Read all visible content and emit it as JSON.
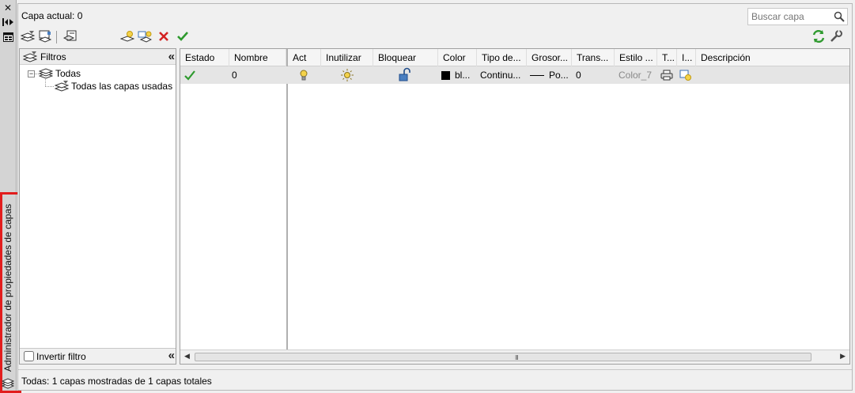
{
  "palette": {
    "side_title": "Administrador de propiedades de capas",
    "close_icon": "close-icon",
    "autohide_icon": "autohide-icon",
    "properties_icon": "properties-icon"
  },
  "header": {
    "current_layer": "Capa actual: 0",
    "search_placeholder": "Buscar capa"
  },
  "toolbar": {
    "icons": [
      "new-property-filter-icon",
      "new-group-filter-icon",
      "layer-states-manager-icon",
      "new-layer-icon",
      "new-layer-vp-frozen-icon",
      "delete-layer-icon",
      "set-current-icon",
      "refresh-icon",
      "settings-icon"
    ]
  },
  "filters": {
    "header": "Filtros",
    "tree": [
      {
        "label": "Todas",
        "expander": "−"
      },
      {
        "label": "Todas las capas usadas"
      }
    ],
    "invert_label": "Invertir filtro"
  },
  "grid": {
    "columns": [
      "Estado",
      "Nombre",
      "Act",
      "Inutilizar",
      "Bloquear",
      "Color",
      "Tipo de...",
      "Grosor...",
      "Trans...",
      "Estilo ...",
      "T...",
      "I...",
      "Descripción"
    ],
    "rows": [
      {
        "nombre": "0",
        "color": "bl...",
        "tipo": "Continu...",
        "grosor": "Po...",
        "trans": "0",
        "estilo": "Color_7"
      }
    ],
    "scroll_grip": "III"
  },
  "status": {
    "text": "Todas: 1 capas mostradas de 1 capas totales"
  },
  "colors": {
    "accent_red": "#e21d1d",
    "check_green": "#2e9a2e",
    "bulb_yellow": "#f4d24a"
  }
}
